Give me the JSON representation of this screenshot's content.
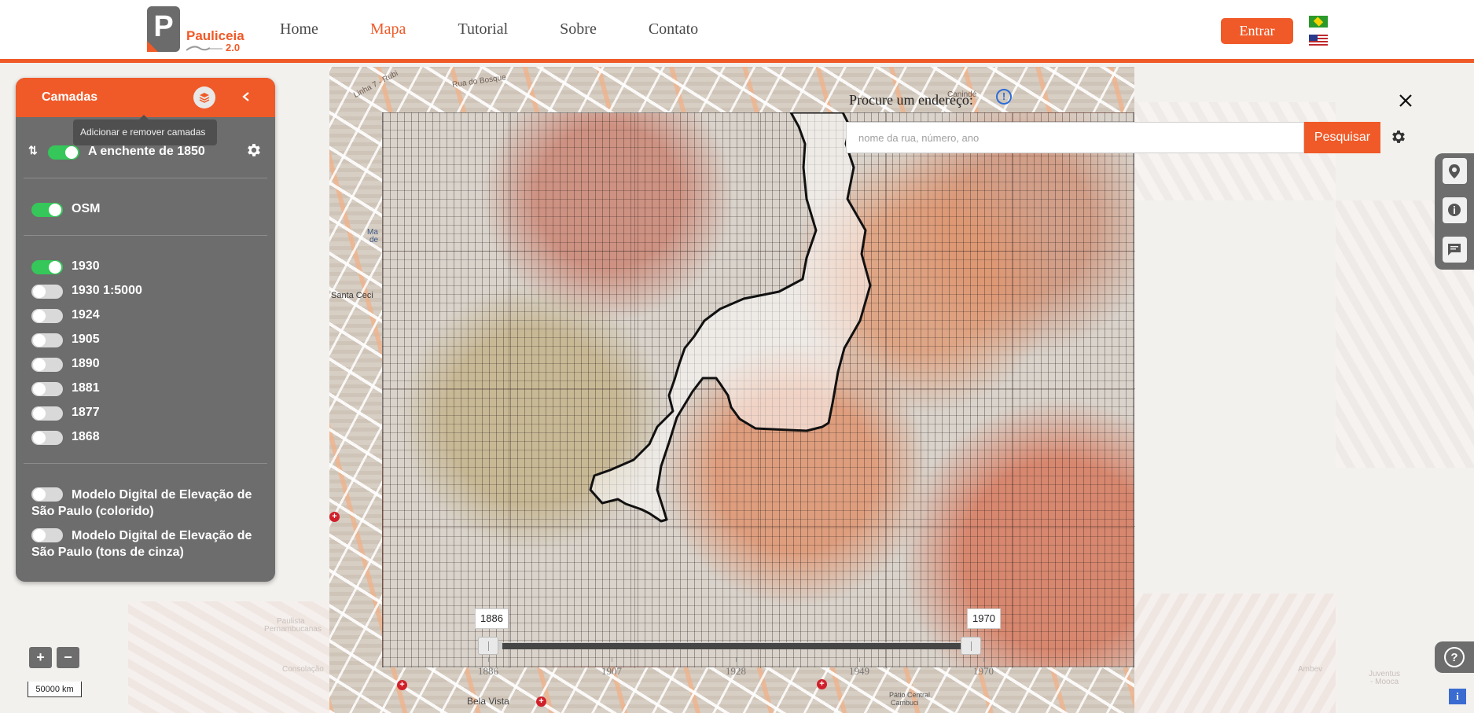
{
  "header": {
    "logo_text": "Pauliceia",
    "logo_version": "2.0",
    "logo_letter": "P",
    "nav": [
      {
        "label": "Home",
        "active": false
      },
      {
        "label": "Mapa",
        "active": true
      },
      {
        "label": "Tutorial",
        "active": false
      },
      {
        "label": "Sobre",
        "active": false
      },
      {
        "label": "Contato",
        "active": false
      }
    ],
    "login_label": "Entrar",
    "languages": [
      "pt-BR",
      "en-US"
    ]
  },
  "layers_panel": {
    "title": "Camadas",
    "tooltip": "Adicionar e remover camadas",
    "overlay_layer": {
      "label": "A enchente de 1850",
      "on": true
    },
    "base_layers": [
      {
        "label": "OSM",
        "on": true
      }
    ],
    "historic_layers": [
      {
        "label": "1930",
        "on": true
      },
      {
        "label": "1930 1:5000",
        "on": false
      },
      {
        "label": "1924",
        "on": false
      },
      {
        "label": "1905",
        "on": false
      },
      {
        "label": "1890",
        "on": false
      },
      {
        "label": "1881",
        "on": false
      },
      {
        "label": "1877",
        "on": false
      },
      {
        "label": "1868",
        "on": false
      }
    ],
    "elevation_layers": [
      {
        "label": "Modelo Digital de Elevação de São Paulo (colorido)",
        "on": false
      },
      {
        "label": "Modelo Digital de Elevação de São Paulo (tons de cinza)",
        "on": false
      }
    ]
  },
  "search": {
    "label": "Procure um endereço:",
    "info_glyph": "!",
    "placeholder": "nome da rua, número, ano",
    "value": "",
    "button_label": "Pesquisar"
  },
  "map": {
    "labels": {
      "rua_do_bosque": "Rua do Bosque",
      "linha": "Linha 7 - Rubi",
      "caninde": "Canindé",
      "santa_cec": "Santa Ceci",
      "ma": "Ma",
      "de": "de",
      "bela_vista": "Bela Vista",
      "patio": "Pátio Central",
      "cambuci": "Cambuci",
      "paulista": "Paulista",
      "pernambucanas": "Pernambucanas",
      "consolacao": "Consolação",
      "juventus": "Juventus",
      "mooca": "- Mooca",
      "ambev": "Ambev"
    },
    "zoom_in": "+",
    "zoom_out": "−",
    "scale": "50000 km"
  },
  "time_slider": {
    "start": 1886,
    "end": 1970,
    "selected_start": "1886",
    "selected_end": "1970",
    "ticks": [
      "1886",
      "1907",
      "1928",
      "1949",
      "1970"
    ]
  },
  "colors": {
    "accent": "#f05a28",
    "panel": "#6d6d6d",
    "toggle_on": "#35c759",
    "info_blue": "#2a6dd8"
  },
  "right_bar_icons": [
    "map-marker-icon",
    "info-icon",
    "comment-icon"
  ],
  "help_glyph": "?",
  "info_small": "i"
}
